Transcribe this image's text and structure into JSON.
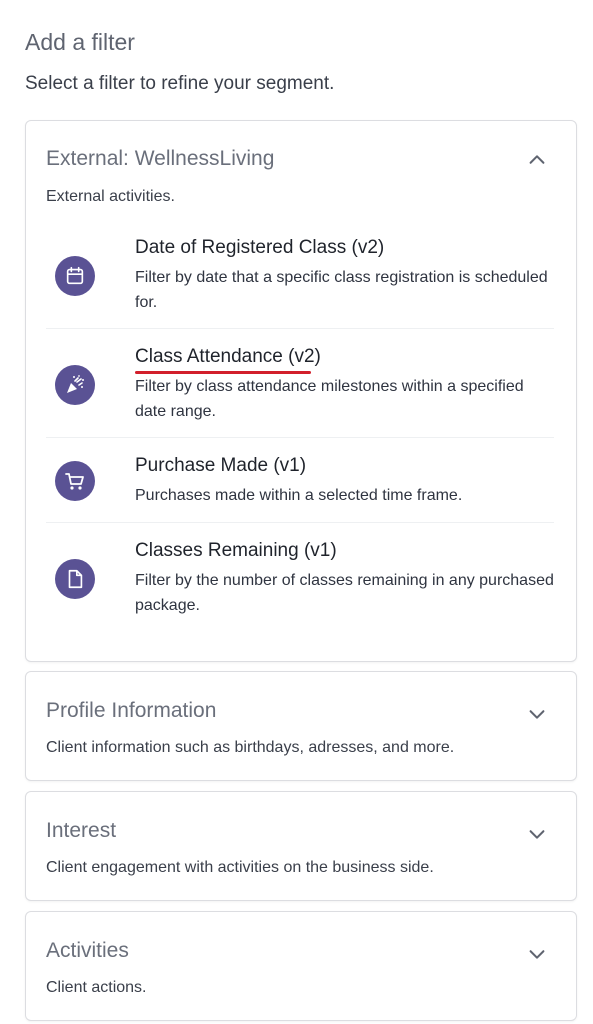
{
  "page": {
    "title": "Add a filter",
    "subtitle": "Select a filter to refine your segment."
  },
  "sections": [
    {
      "title": "External: WellnessLiving",
      "description": "External activities.",
      "expanded": true,
      "chevron": "chevron-up-icon",
      "items": [
        {
          "title": "Date of Registered Class (v2)",
          "description": "Filter by date that a specific class registration is scheduled for.",
          "icon": "calendar-icon"
        },
        {
          "title_main": "Class Attendance",
          "title_suffix": " (v2)",
          "description": "Filter by class attendance milestones within a specified date range.",
          "icon": "party-popper-icon"
        },
        {
          "title": "Purchase Made (v1)",
          "description": "Purchases made within a selected time frame.",
          "icon": "cart-icon"
        },
        {
          "title": "Classes Remaining (v1)",
          "description": "Filter by the number of classes remaining in any purchased package.",
          "icon": "document-icon"
        }
      ]
    },
    {
      "title": "Profile Information",
      "description": "Client information such as birthdays, adresses, and more.",
      "expanded": false,
      "chevron": "chevron-down-icon"
    },
    {
      "title": "Interest",
      "description": "Client engagement with activities on the business side.",
      "expanded": false,
      "chevron": "chevron-down-icon"
    },
    {
      "title": "Activities",
      "description": "Client actions.",
      "expanded": false,
      "chevron": "chevron-down-icon"
    }
  ],
  "colors": {
    "icon_bg": "#5a5294",
    "annotation_underline": "#d21f2b"
  }
}
